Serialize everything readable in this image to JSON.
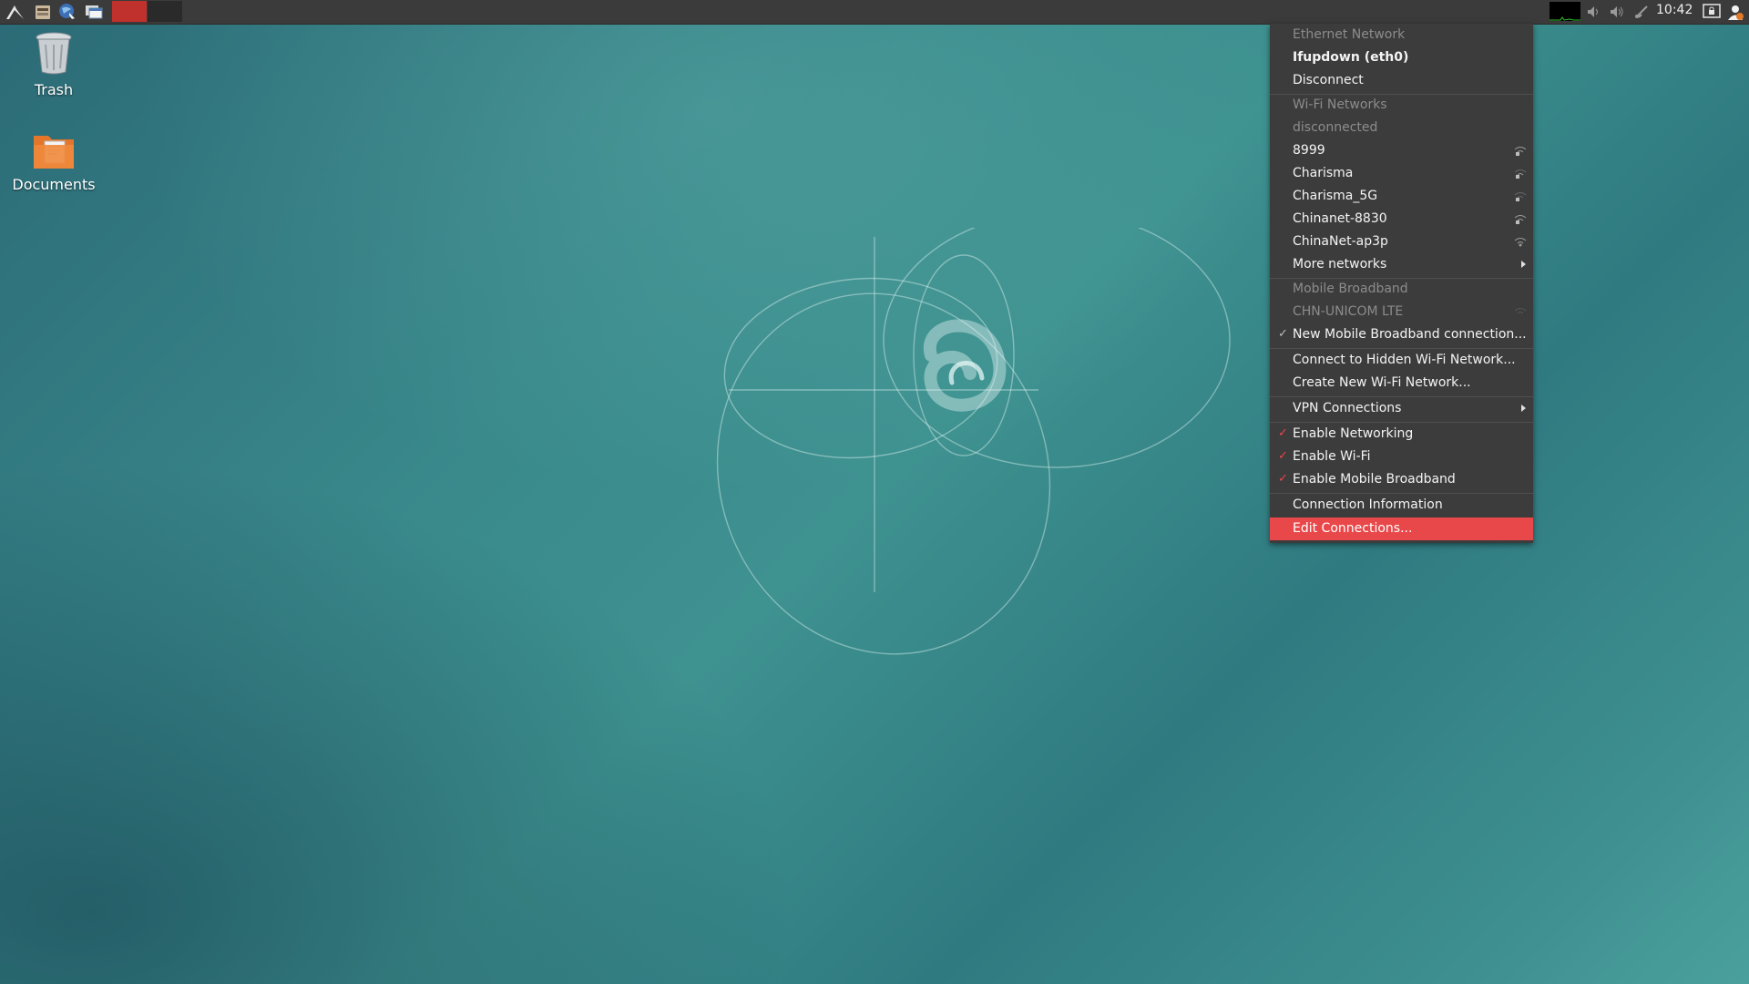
{
  "panel": {
    "clock": "10:42",
    "launchers": [
      "app-menu-icon",
      "file-manager-icon",
      "web-browser-icon",
      "show-desktop-icon"
    ],
    "tray": [
      "cpu-graph",
      "volume-icon",
      "volume-icon",
      "network-icon",
      "lock-screen-icon",
      "user-icon"
    ]
  },
  "desktop": {
    "icons": [
      {
        "label": "Trash",
        "icon": "trash-icon"
      },
      {
        "label": "Documents",
        "icon": "folder-icon"
      }
    ]
  },
  "menu": {
    "ethernet_header": "Ethernet Network",
    "ethernet_conn": "Ifupdown (eth0)",
    "disconnect": "Disconnect",
    "wifi_header": "Wi-Fi Networks",
    "wifi_status": "disconnected",
    "wifi_networks": [
      "8999",
      "Charisma",
      "Charisma_5G",
      "Chinanet-8830",
      "ChinaNet-ap3p"
    ],
    "more_networks": "More networks",
    "mobile_header": "Mobile Broadband",
    "mobile_provider": "CHN-UNICOM LTE",
    "new_mobile": "New Mobile Broadband connection...",
    "hidden_wifi": "Connect to Hidden Wi-Fi Network...",
    "create_wifi": "Create New Wi-Fi Network...",
    "vpn": "VPN Connections",
    "enable_networking": "Enable Networking",
    "enable_wifi": "Enable Wi-Fi",
    "enable_mobile": "Enable Mobile Broadband",
    "connection_info": "Connection Information",
    "edit_connections": "Edit Connections...",
    "check_glyph": "✓",
    "accent_color": "#e8484a"
  }
}
